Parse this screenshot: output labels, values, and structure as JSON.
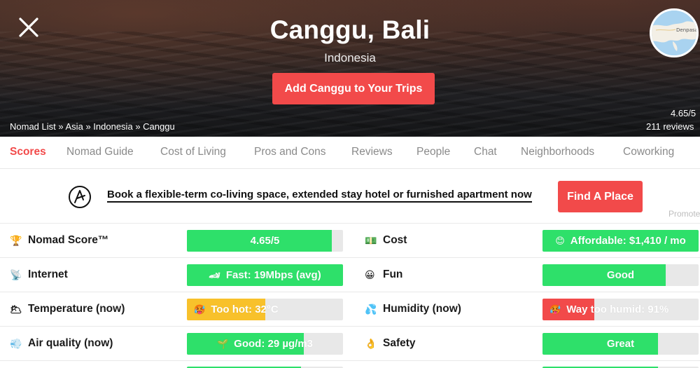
{
  "hero": {
    "title": "Canggu, Bali",
    "country": "Indonesia",
    "add_trip_label": "Add Canggu to Your Trips",
    "rating_score": "4.65/5",
    "rating_reviews": "211 reviews",
    "map_label": "Denpasar"
  },
  "breadcrumb": {
    "items": [
      "Nomad List",
      "Asia",
      "Indonesia",
      "Canggu"
    ],
    "separator": "»"
  },
  "tabs": [
    "Scores",
    "Nomad Guide",
    "Cost of Living",
    "Pros and Cons",
    "Reviews",
    "People",
    "Chat",
    "Neighborhoods",
    "Coworking"
  ],
  "active_tab": "Scores",
  "promo": {
    "text": "Book a flexible-term co-living space, extended stay hotel or furnished apartment now",
    "button": "Find A Place",
    "promoted": "Promoted"
  },
  "colors": {
    "accent": "#f24a4a",
    "good": "#2ee06a",
    "warn": "#f8c12b",
    "bad": "#f24a4a",
    "track": "#e8e8e8"
  },
  "scores_left": [
    {
      "icon": "trophy-icon",
      "emoji": "🏆",
      "label": "Nomad Score™",
      "value": "4.65/5",
      "bar_emoji": "",
      "level": 0.93,
      "status": "good"
    },
    {
      "icon": "satellite-icon",
      "emoji": "📡",
      "label": "Internet",
      "value": "Fast: 19Mbps (avg)",
      "bar_emoji": "🏎",
      "level": 1.0,
      "status": "good"
    },
    {
      "icon": "cloud-icon",
      "emoji": "🌥",
      "label": "Temperature (now)",
      "value": "Too hot: 32°C",
      "bar_emoji": "🥵",
      "level": 0.5,
      "status": "warn"
    },
    {
      "icon": "wind-icon",
      "emoji": "💨",
      "label": "Air quality (now)",
      "value": "Good: 29 µg/m3",
      "bar_emoji": "🌱",
      "level": 0.75,
      "status": "good"
    }
  ],
  "scores_right": [
    {
      "icon": "money-icon",
      "emoji": "💵",
      "label": "Cost",
      "value": "Affordable: $1,410 / mo",
      "bar_emoji": "😊",
      "level": 1.0,
      "status": "good"
    },
    {
      "icon": "smile-icon",
      "emoji": "😀",
      "label": "Fun",
      "value": "Good",
      "bar_emoji": "",
      "level": 0.79,
      "status": "good"
    },
    {
      "icon": "droplets-icon",
      "emoji": "💦",
      "label": "Humidity (now)",
      "value": "Way too humid: 91%",
      "bar_emoji": "🥵",
      "level": 0.33,
      "status": "bad"
    },
    {
      "icon": "ok-hand-icon",
      "emoji": "👌",
      "label": "Safety",
      "value": "Great",
      "bar_emoji": "",
      "level": 0.74,
      "status": "good"
    }
  ]
}
